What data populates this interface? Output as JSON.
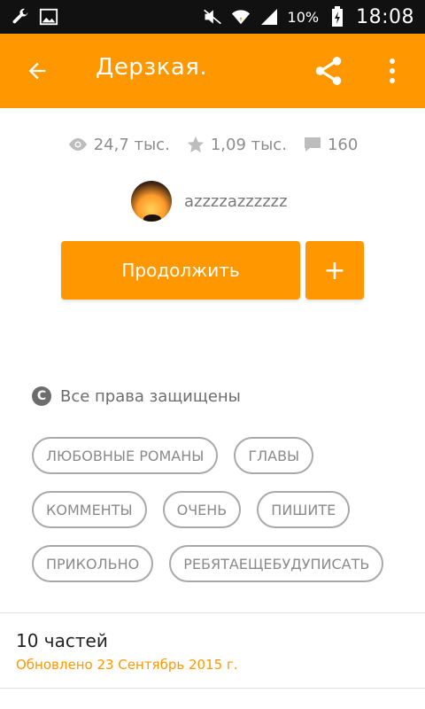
{
  "status_bar": {
    "battery": "10%",
    "time": "18:08",
    "left_icons": [
      "wrench-icon",
      "image-icon"
    ],
    "right_icons": [
      "mute-icon",
      "wifi-icon",
      "signal-icon",
      "battery-charging-icon"
    ]
  },
  "appbar": {
    "title": "Дерзкая.",
    "color": "#FF9800"
  },
  "stats": {
    "views": "24,7 тыс.",
    "votes": "1,09 тыс.",
    "comments": "160"
  },
  "author": {
    "name": "azzzzazzzzzz"
  },
  "actions": {
    "continue_label": "Продолжить",
    "add_label": "+"
  },
  "copyright": {
    "text": "Все права защищены",
    "icon": "C"
  },
  "tags": [
    [
      "ЛЮБОВНЫЕ РОМАНЫ",
      "ГЛАВЫ"
    ],
    [
      "КОММЕНТЫ",
      "ОЧЕНЬ",
      "ПИШИТЕ"
    ],
    [
      "ПРИКОЛЬНО",
      "РЕБЯТАЕЩЕБУДУПИСАТЬ"
    ]
  ],
  "parts": {
    "title": "10 частей",
    "updated": "Обновлено 23 Сентябрь 2015 г."
  }
}
